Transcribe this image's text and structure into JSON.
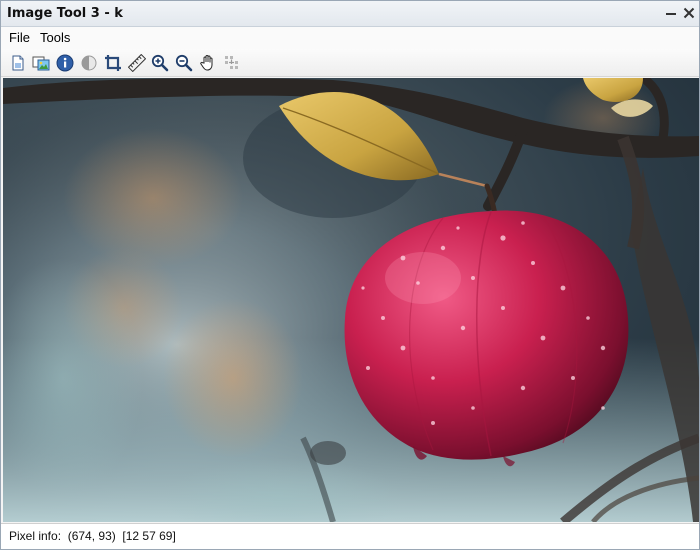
{
  "window": {
    "title": "Image Tool 3 - k"
  },
  "menu": {
    "file": "File",
    "tools": "Tools"
  },
  "toolbar": {
    "icons": [
      "new-image-icon",
      "copy-image-icon",
      "info-icon",
      "contrast-icon",
      "crop-icon",
      "ruler-icon",
      "zoom-in-icon",
      "zoom-out-icon",
      "pan-hand-icon",
      "pixel-region-icon"
    ]
  },
  "status": {
    "label": "Pixel info:",
    "coords": "(674, 93)",
    "rgb": "[12 57 69]"
  },
  "colors": {
    "accent": "#1a5fb4",
    "apple": "#c9204f",
    "leaf": "#c9a441"
  }
}
